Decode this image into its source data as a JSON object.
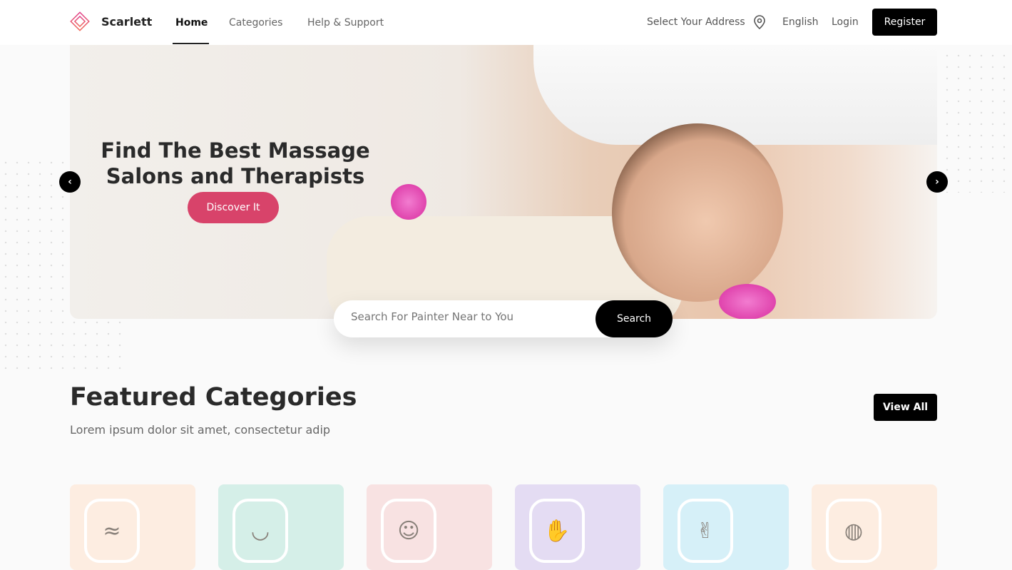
{
  "header": {
    "brand": "Scarlett",
    "nav": [
      "Home",
      "Categories",
      "Help & Support"
    ],
    "address": "Select Your Address",
    "language": "English",
    "login": "Login",
    "register": "Register"
  },
  "hero": {
    "title": "Find The Best Massage Salons and Therapists",
    "cta": "Discover It"
  },
  "search": {
    "placeholder": "Search For Painter Near to You",
    "button": "Search"
  },
  "featured": {
    "title": "Featured Categories",
    "subtitle": "Lorem ipsum dolor sit amet, consectetur adip",
    "view_all": "View All",
    "cards": [
      {
        "icon": "hair-icon",
        "color": "#fdede1"
      },
      {
        "icon": "eyebrow-icon",
        "color": "#d5efe8"
      },
      {
        "icon": "facial-icon",
        "color": "#f8e2e2"
      },
      {
        "icon": "massage-icon",
        "color": "#e4dcf3"
      },
      {
        "icon": "nail-icon",
        "color": "#d6f0f8"
      },
      {
        "icon": "makeup-icon",
        "color": "#fdede1"
      }
    ]
  },
  "colors": {
    "accent": "#d8436a",
    "primary": "#000000"
  }
}
